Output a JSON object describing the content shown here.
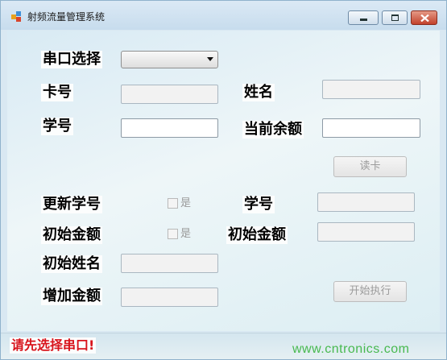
{
  "window": {
    "title": "射频流量管理系统"
  },
  "form": {
    "port_label": "串口选择",
    "card_label": "卡号",
    "name_label": "姓名",
    "student_id_label": "学号",
    "balance_label": "当前余额",
    "read_card_button": "读卡",
    "update_student_id_label": "更新学号",
    "update_student_id_checkbox_label": "是",
    "initial_amount_label": "初始金额",
    "initial_amount_checkbox_label": "是",
    "right_student_id_label": "学号",
    "right_initial_amount_label": "初始金额",
    "initial_name_label": "初始姓名",
    "add_amount_label": "增加金额",
    "start_button": "开始执行"
  },
  "status": {
    "message": "请先选择串口!"
  },
  "watermark": {
    "text": "www.cntronics.com"
  },
  "colors": {
    "status_text": "#d8131b",
    "watermark": "#48b94f",
    "close_button": "#c2422c"
  }
}
